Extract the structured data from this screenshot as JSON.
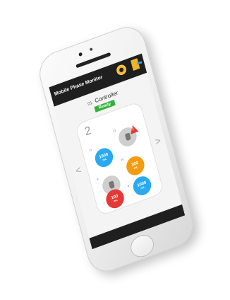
{
  "app": {
    "title": "Mobile Phase Monitor"
  },
  "controller": {
    "number": "01",
    "label": "Controller",
    "status": "Ready"
  },
  "panel": {
    "number": "2"
  },
  "slots": [
    {
      "slot": "11",
      "value": "1000",
      "unit": "mL",
      "color": "#29aaf0"
    },
    {
      "slot": "12",
      "value": "",
      "unit": "",
      "color": "#cfcfcf",
      "state": "empty-alert"
    },
    {
      "slot": "9",
      "value": "",
      "unit": "",
      "color": "#cfcfcf",
      "state": "empty"
    },
    {
      "slot": "10",
      "value": "300",
      "unit": "mL",
      "color": "#f59b0f"
    },
    {
      "slot": "7",
      "value": "100",
      "unit": "mL",
      "color": "#e53935"
    },
    {
      "slot": "8",
      "value": "1000",
      "unit": "mL",
      "color": "#29aaf0"
    }
  ],
  "nav": {
    "prev": "<",
    "next": ">"
  },
  "icons": {
    "settings": "gear-icon",
    "exit": "exit-icon",
    "alert": "alert-icon",
    "bottle": "bottle-icon"
  }
}
